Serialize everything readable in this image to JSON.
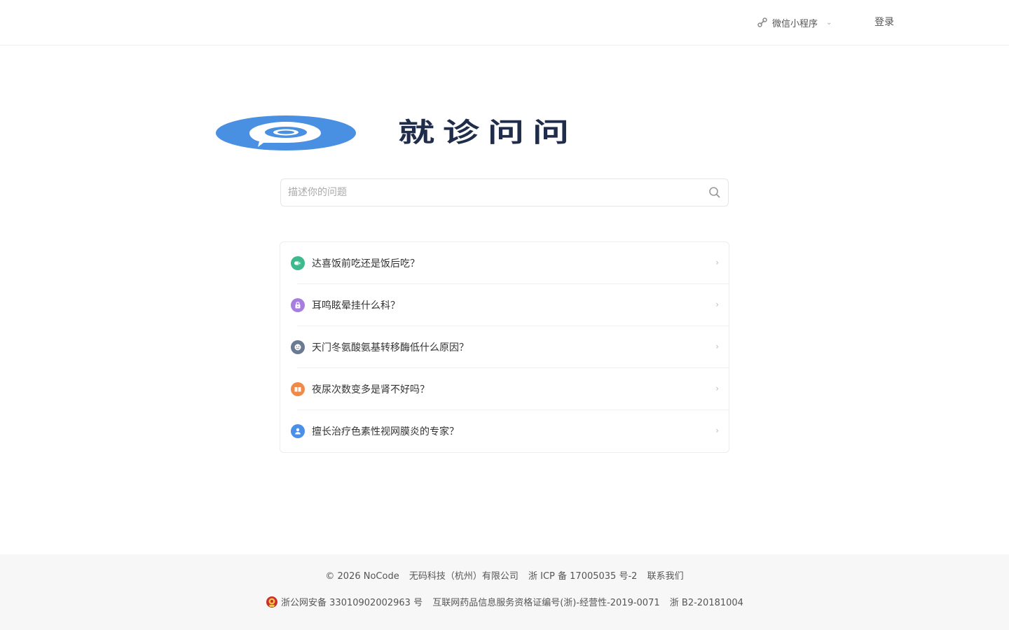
{
  "header": {
    "mini_program_label": "微信小程序",
    "login_label": "登录"
  },
  "logo": {
    "text": "就诊问问",
    "brand_color": "#4a90e2",
    "text_color": "#1f2d4b"
  },
  "search": {
    "placeholder": "描述你的问题",
    "value": ""
  },
  "questions": [
    {
      "text": "达喜饭前吃还是饭后吃？",
      "icon": "pill-icon",
      "color": "#3dba8c"
    },
    {
      "text": "耳鸣眩晕挂什么科？",
      "icon": "lock-icon",
      "color": "#a77ee0"
    },
    {
      "text": "天门冬氨酸氨基转移酶低什么原因？",
      "icon": "face-icon",
      "color": "#6b7a93"
    },
    {
      "text": "夜尿次数变多是肾不好吗？",
      "icon": "book-icon",
      "color": "#f08a4b"
    },
    {
      "text": "擅长治疗色素性视网膜炎的专家？",
      "icon": "user-icon",
      "color": "#4a8fe8"
    }
  ],
  "footer": {
    "copyright": "© 2026 NoCode",
    "company": "无码科技（杭州）有限公司",
    "icp": "浙 ICP 备 17005035 号-2",
    "contact": "联系我们",
    "police": "浙公网安备 33010902002963 号",
    "drug_license": "互联网药品信息服务资格证编号(浙)-经营性-2019-0071",
    "b2": "浙 B2-20181004"
  }
}
